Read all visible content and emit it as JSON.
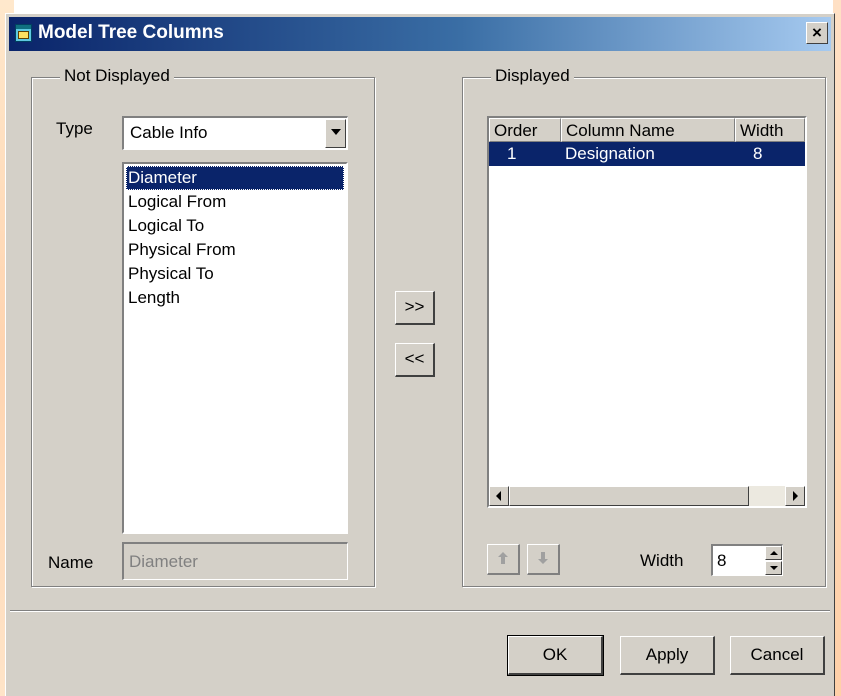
{
  "window": {
    "title": "Model Tree Columns",
    "close_label": "×"
  },
  "not_displayed": {
    "group_label": "Not Displayed",
    "type_label": "Type",
    "type_value": "Cable Info",
    "items": [
      "Diameter",
      "Logical From",
      "Logical To",
      "Physical From",
      "Physical To",
      "Length"
    ],
    "selected_index": 0,
    "name_label": "Name",
    "name_value": "Diameter"
  },
  "transfer": {
    "add_label": ">>",
    "remove_label": "<<"
  },
  "displayed": {
    "group_label": "Displayed",
    "columns": [
      "Order",
      "Column Name",
      "Width"
    ],
    "rows": [
      {
        "order": "1",
        "column_name": "Designation",
        "width": "8"
      }
    ],
    "width_label": "Width",
    "width_value": "8"
  },
  "footer": {
    "ok_label": "OK",
    "apply_label": "Apply",
    "cancel_label": "Cancel"
  },
  "icons": {
    "window_icon": "window-icon",
    "move_up": "arrow-up-icon",
    "move_down": "arrow-down-icon"
  },
  "colors": {
    "title_start": "#0a246a",
    "title_end": "#a6caf0",
    "dialog_face": "#d4d0c8",
    "selection": "#0a246a"
  }
}
